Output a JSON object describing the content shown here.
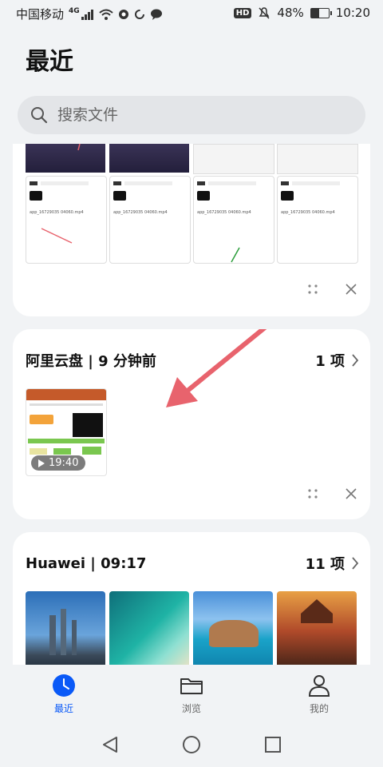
{
  "status_bar": {
    "carrier": "中国移动",
    "network": "4G",
    "hd": "HD",
    "battery": "48%",
    "battery_level": 0.48,
    "time": "10:20"
  },
  "page": {
    "title": "最近"
  },
  "search": {
    "placeholder": "搜索文件"
  },
  "cards": [
    {
      "screenshot_text": "app_16729035 04060.mp4"
    },
    {
      "source": "阿里云盘 | 9 分钟前",
      "count": "1 项",
      "video_duration": "19:40"
    },
    {
      "source": "Huawei | 09:17",
      "count": "11 项"
    }
  ],
  "tabs": [
    {
      "label": "最近",
      "icon": "clock-icon"
    },
    {
      "label": "浏览",
      "icon": "folder-icon"
    },
    {
      "label": "我的",
      "icon": "person-icon"
    }
  ],
  "colors": {
    "accent": "#0a59f7",
    "annotation_arrow": "#e8636d"
  }
}
